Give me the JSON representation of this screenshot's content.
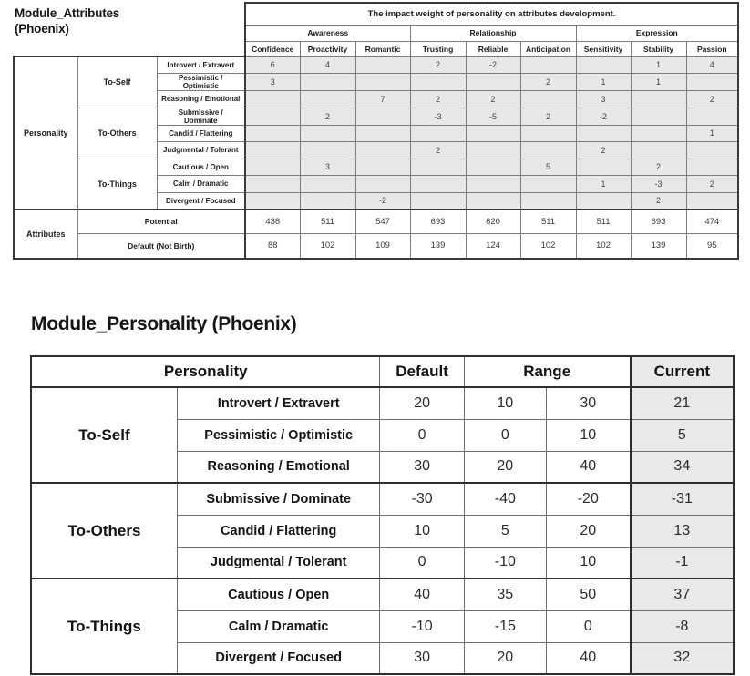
{
  "attributes_module": {
    "title_line1": "Module_Attributes",
    "title_line2": "(Phoenix)",
    "matrix_title": "The impact weight of personality on attributes development.",
    "row_section_personality": "Personality",
    "row_section_attributes": "Attributes",
    "groups": [
      {
        "name": "Awareness",
        "columns": [
          "Confidence",
          "Proactivity",
          "Romantic"
        ]
      },
      {
        "name": "Relationship",
        "columns": [
          "Trusting",
          "Reliable",
          "Anticipation"
        ]
      },
      {
        "name": "Expression",
        "columns": [
          "Sensitivity",
          "Stability",
          "Passion"
        ]
      }
    ],
    "subgroups": [
      {
        "name": "To-Self",
        "traits": [
          "Introvert / Extravert",
          "Pessimistic / Optimistic",
          "Reasoning / Emotional"
        ]
      },
      {
        "name": "To-Others",
        "traits": [
          "Submissive / Dominate",
          "Candid / Flattering",
          "Judgmental / Tolerant"
        ]
      },
      {
        "name": "To-Things",
        "traits": [
          "Cautious / Open",
          "Calm / Dramatic",
          "Divergent / Focused"
        ]
      }
    ],
    "weights": [
      {
        "trait": "Introvert / Extravert",
        "values": [
          "6",
          "4",
          "",
          "2",
          "-2",
          "",
          "",
          "1",
          "4"
        ]
      },
      {
        "trait": "Pessimistic / Optimistic",
        "values": [
          "3",
          "",
          "",
          "",
          "",
          "2",
          "1",
          "1",
          ""
        ]
      },
      {
        "trait": "Reasoning / Emotional",
        "values": [
          "",
          "",
          "7",
          "2",
          "2",
          "",
          "3",
          "",
          "2"
        ]
      },
      {
        "trait": "Submissive / Dominate",
        "values": [
          "",
          "2",
          "",
          "-3",
          "-5",
          "2",
          "-2",
          "",
          ""
        ]
      },
      {
        "trait": "Candid / Flattering",
        "values": [
          "",
          "",
          "",
          "",
          "",
          "",
          "",
          "",
          "1"
        ]
      },
      {
        "trait": "Judgmental / Tolerant",
        "values": [
          "",
          "",
          "",
          "2",
          "",
          "",
          "2",
          "",
          ""
        ]
      },
      {
        "trait": "Cautious / Open",
        "values": [
          "",
          "3",
          "",
          "",
          "",
          "5",
          "",
          "2",
          ""
        ]
      },
      {
        "trait": "Calm / Dramatic",
        "values": [
          "",
          "",
          "",
          "",
          "",
          "",
          "1",
          "-3",
          "2"
        ]
      },
      {
        "trait": "Divergent / Focused",
        "values": [
          "",
          "",
          "-2",
          "",
          "",
          "",
          "",
          "2",
          ""
        ]
      }
    ],
    "attribute_rows": [
      {
        "label": "Potential",
        "values": [
          "438",
          "511",
          "547",
          "693",
          "620",
          "511",
          "511",
          "693",
          "474"
        ]
      },
      {
        "label": "Default (Not Birth)",
        "values": [
          "88",
          "102",
          "109",
          "139",
          "124",
          "102",
          "102",
          "139",
          "95"
        ]
      }
    ]
  },
  "personality_module": {
    "title": "Module_Personality (Phoenix)",
    "headers": {
      "personality": "Personality",
      "default": "Default",
      "range": "Range",
      "current": "Current"
    },
    "groups": [
      {
        "name": "To-Self",
        "rows": [
          {
            "trait": "Introvert / Extravert",
            "default": "20",
            "range_min": "10",
            "range_max": "30",
            "current": "21"
          },
          {
            "trait": "Pessimistic / Optimistic",
            "default": "0",
            "range_min": "0",
            "range_max": "10",
            "current": "5"
          },
          {
            "trait": "Reasoning / Emotional",
            "default": "30",
            "range_min": "20",
            "range_max": "40",
            "current": "34"
          }
        ]
      },
      {
        "name": "To-Others",
        "rows": [
          {
            "trait": "Submissive / Dominate",
            "default": "-30",
            "range_min": "-40",
            "range_max": "-20",
            "current": "-31"
          },
          {
            "trait": "Candid / Flattering",
            "default": "10",
            "range_min": "5",
            "range_max": "20",
            "current": "13"
          },
          {
            "trait": "Judgmental / Tolerant",
            "default": "0",
            "range_min": "-10",
            "range_max": "10",
            "current": "-1"
          }
        ]
      },
      {
        "name": "To-Things",
        "rows": [
          {
            "trait": "Cautious / Open",
            "default": "40",
            "range_min": "35",
            "range_max": "50",
            "current": "37"
          },
          {
            "trait": "Calm / Dramatic",
            "default": "-10",
            "range_min": "-15",
            "range_max": "0",
            "current": "-8"
          },
          {
            "trait": "Divergent / Focused",
            "default": "30",
            "range_min": "20",
            "range_max": "40",
            "current": "32"
          }
        ]
      }
    ]
  },
  "colors": {
    "grid_line": "#6f6f6f",
    "outer_border": "#2e2e2e",
    "data_cell_bg": "#e8e8e8",
    "current_col_bg": "#e9e9e9",
    "page_bg": "#ffffff"
  }
}
